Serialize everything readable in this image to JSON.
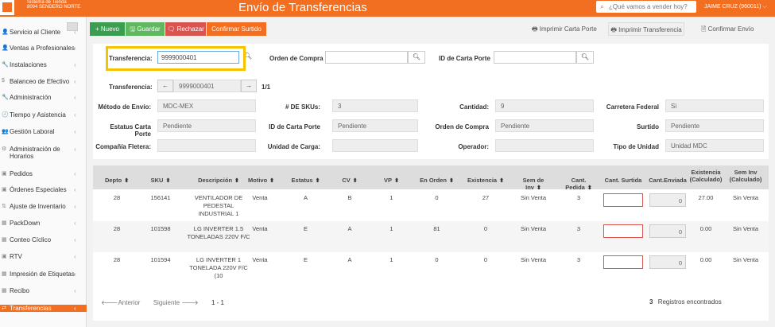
{
  "app": {
    "system_line1": "Sistema de Tienda",
    "system_line2": "8094 SENDERO NORTE",
    "title": "Envío de Transferencias",
    "search_placeholder": "¿Qué vamos a vender hoy?",
    "user": "JAIME CRUZ (960011)",
    "user_caret": "⌵"
  },
  "sidebar": {
    "items": [
      {
        "icon": "👤",
        "label": "Servicio al Cliente"
      },
      {
        "icon": "👤",
        "label": "Ventas a Profesionales"
      },
      {
        "icon": "🔧",
        "label": "Instalaciones"
      },
      {
        "icon": "$",
        "label": "Balanceo de Efectivo"
      },
      {
        "icon": "🔧",
        "label": "Administración"
      },
      {
        "icon": "🕘",
        "label": "Tiempo y Asistencia"
      },
      {
        "icon": "👥",
        "label": "Gestión Laboral"
      },
      {
        "icon": "⚙",
        "label": "Administración de Horarios"
      },
      {
        "icon": "▣",
        "label": "Pedidos"
      },
      {
        "icon": "▣",
        "label": "Órdenes Especiales"
      },
      {
        "icon": "⇅",
        "label": "Ajuste de Inventario"
      },
      {
        "icon": "▦",
        "label": "PackDown"
      },
      {
        "icon": "▦",
        "label": "Conteo Cíclico"
      },
      {
        "icon": "▣",
        "label": "RTV"
      },
      {
        "icon": "▦",
        "label": "Impresión de Etiquetas"
      },
      {
        "icon": "▦",
        "label": "Recibo"
      },
      {
        "icon": "⇄",
        "label": "Transferencias"
      }
    ],
    "chevron": "‹"
  },
  "toolbar": {
    "nuevo": "+ Nuevo",
    "guardar": "🖫 Guardar",
    "rechazar": "🗨 Rechazar",
    "confirmar_surtido": "Confirmar Surtido",
    "imprimir_carta": "🖶 Imprimir Carta Porte",
    "imprimir_transferencia": "🖶 Imprimir Transferencia",
    "confirmar_envio": "🗎 Confirmar Envío"
  },
  "search_form": {
    "transferencia_label": "Transferencia:",
    "transferencia_value": "9999000401",
    "orden_label": "Orden de Compra",
    "orden_value": "",
    "carta_label": "ID de Carta Porte",
    "carta_value": ""
  },
  "nav": {
    "label": "Transferencia:",
    "prev": "←",
    "value": "9999000401",
    "next": "→",
    "count": "1/1"
  },
  "details": {
    "metodo_label": "Método de Envío:",
    "metodo_value": "MDC-MEX",
    "skus_label": "# DE SKUs:",
    "skus_value": "3",
    "cantidad_label": "Cantidad:",
    "cantidad_value": "9",
    "carretera_label": "Carretera Federal",
    "carretera_value": "Si",
    "estatus_label": "Estatus Carta Porte",
    "estatus_value": "Pendiente",
    "idcarta_label": "ID de Carta Porte",
    "idcarta_value": "Pendiente",
    "orden_label": "Orden de Compra",
    "orden_value": "Pendiente",
    "surtido_label": "Surtido",
    "surtido_value": "Pendiente",
    "fletera_label": "Compañía Fletera:",
    "fletera_value": "",
    "unidad_label": "Unidad de Carga:",
    "unidad_value": "",
    "operador_label": "Operador:",
    "operador_value": "",
    "tipo_label": "Tipo de Unidad",
    "tipo_value": "Unidad MDC"
  },
  "table": {
    "headers": {
      "depto": "Depto",
      "sku": "SKU",
      "descripcion": "Descripción",
      "motivo": "Motivo",
      "estatus": "Estatus",
      "cv": "CV",
      "vp": "VP",
      "en_orden": "En Orden",
      "existencia": "Existencia",
      "sem_inv": "Sem de Inv",
      "cant_pedida": "Cant. Pedida",
      "cant_surtida": "Cant. Surtida",
      "cant_enviada": "Cant.Enviada",
      "existencia_calc": "Existencia (Calculado)",
      "sem_inv_calc": "Sem Inv (Calculado)"
    },
    "sort_glyph": "⬍",
    "rows": [
      {
        "depto": "28",
        "sku": "156141",
        "descripcion": "VENTILADOR DE PEDESTAL INDUSTRIAL 1",
        "motivo": "Venta",
        "estatus": "A",
        "cv": "B",
        "vp": "1",
        "en_orden": "0",
        "existencia": "27",
        "sem_inv": "Sin Venta",
        "cant_pedida": "3",
        "cant_enviada": "0",
        "existencia_calc": "27.00",
        "sem_inv_calc": "Sin Venta"
      },
      {
        "depto": "28",
        "sku": "101598",
        "descripcion": "LG INVERTER 1.5 TONELADAS 220V F/C",
        "motivo": "Venta",
        "estatus": "E",
        "cv": "A",
        "vp": "1",
        "en_orden": "81",
        "existencia": "0",
        "sem_inv": "Sin Venta",
        "cant_pedida": "3",
        "cant_enviada": "0",
        "existencia_calc": "0.00",
        "sem_inv_calc": "Sin Venta"
      },
      {
        "depto": "28",
        "sku": "101594",
        "descripcion": "LG INVERTER 1 TONELADA 220V F/C (10",
        "motivo": "Venta",
        "estatus": "E",
        "cv": "A",
        "vp": "1",
        "en_orden": "0",
        "existencia": "0",
        "sem_inv": "Sin Venta",
        "cant_pedida": "3",
        "cant_enviada": "0",
        "existencia_calc": "0.00",
        "sem_inv_calc": "Sin Venta"
      }
    ],
    "pagination": {
      "prev": "🡐Anterior",
      "next": "Siguiente 🡒",
      "range": "1 - 1"
    },
    "records_count": "3",
    "records_label": "Registros encontrados"
  },
  "colors": {
    "brand": "#f26e21",
    "nuevo": "#3a9d4f",
    "guardar": "#5fb85f",
    "rechazar": "#d9534f",
    "highlight": "#f6c300"
  }
}
